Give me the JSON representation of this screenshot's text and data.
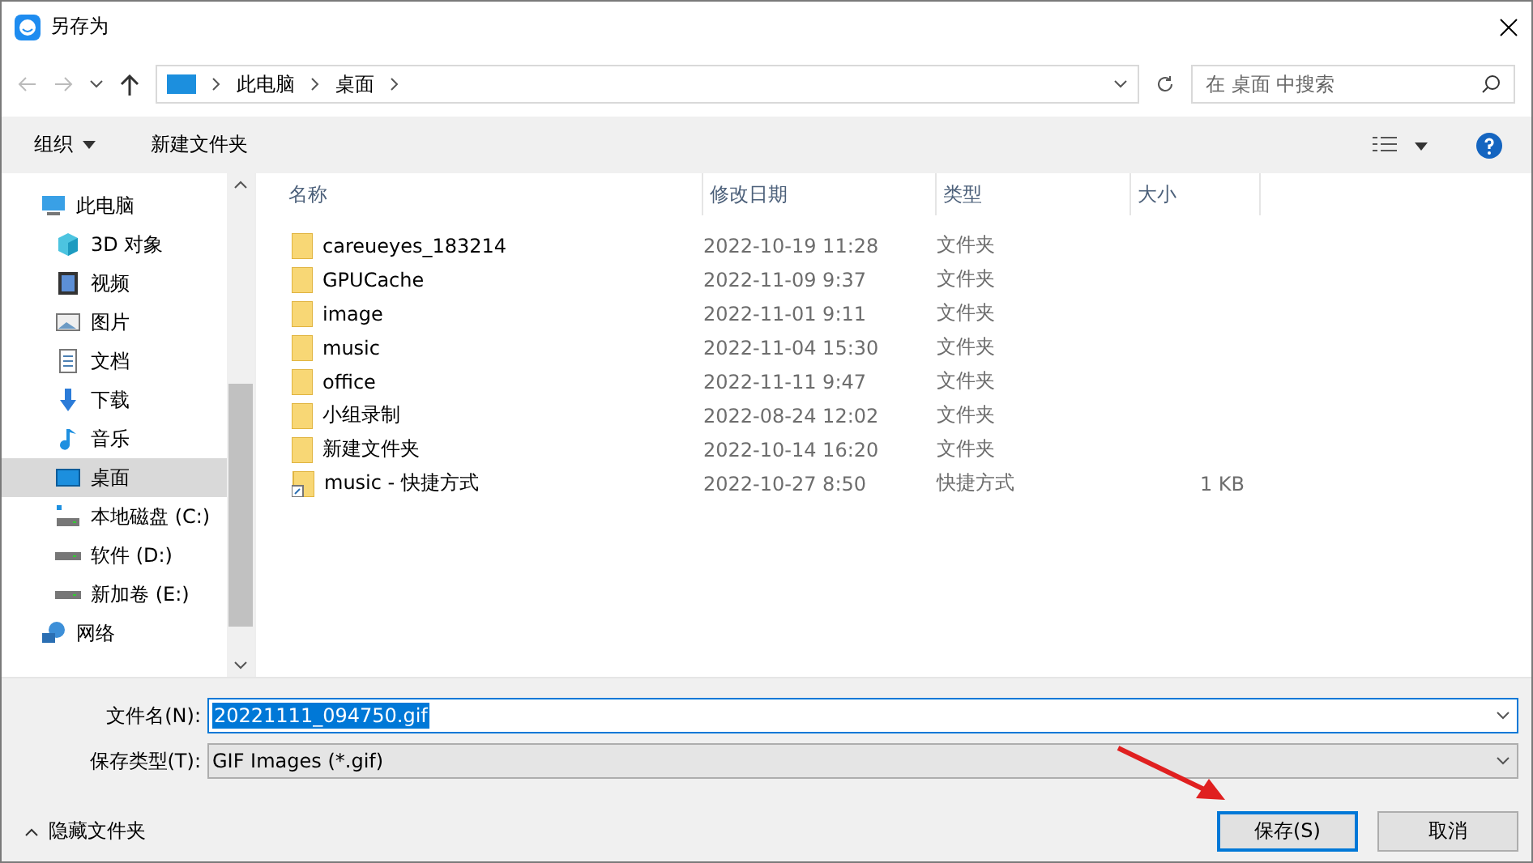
{
  "window": {
    "title": "另存为"
  },
  "nav": {
    "path": [
      "此电脑",
      "桌面"
    ],
    "search_placeholder": "在 桌面 中搜索"
  },
  "toolbar": {
    "organize": "组织",
    "new_folder": "新建文件夹"
  },
  "sidebar": {
    "items": [
      {
        "label": "此电脑",
        "kind": "pc",
        "selected": false,
        "children": [
          {
            "label": "3D 对象",
            "kind": "cube",
            "selected": false
          },
          {
            "label": "视频",
            "kind": "video",
            "selected": false
          },
          {
            "label": "图片",
            "kind": "picture",
            "selected": false
          },
          {
            "label": "文档",
            "kind": "doc",
            "selected": false
          },
          {
            "label": "下载",
            "kind": "download",
            "selected": false
          },
          {
            "label": "音乐",
            "kind": "music",
            "selected": false
          },
          {
            "label": "桌面",
            "kind": "desktop",
            "selected": true
          },
          {
            "label": "本地磁盘 (C:)",
            "kind": "system-drive",
            "selected": false
          },
          {
            "label": "软件 (D:)",
            "kind": "drive",
            "selected": false
          },
          {
            "label": "新加卷 (E:)",
            "kind": "drive",
            "selected": false
          }
        ]
      },
      {
        "label": "网络",
        "kind": "network",
        "selected": false
      }
    ]
  },
  "table": {
    "columns": [
      "名称",
      "修改日期",
      "类型",
      "大小"
    ],
    "rows": [
      {
        "name": "careueyes_183214",
        "date": "2022-10-19 11:28",
        "type": "文件夹",
        "kind": "folder"
      },
      {
        "name": "GPUCache",
        "date": "2022-11-09 9:37",
        "type": "文件夹",
        "kind": "folder"
      },
      {
        "name": "image",
        "date": "2022-11-01 9:11",
        "type": "文件夹",
        "kind": "folder"
      },
      {
        "name": "music",
        "date": "2022-11-04 15:30",
        "type": "文件夹",
        "kind": "folder"
      },
      {
        "name": "office",
        "date": "2022-11-11 9:47",
        "type": "文件夹",
        "kind": "folder"
      },
      {
        "name": "小组录制",
        "date": "2022-08-24 12:02",
        "type": "文件夹",
        "kind": "folder"
      },
      {
        "name": "新建文件夹",
        "date": "2022-10-14 16:20",
        "type": "文件夹",
        "kind": "folder"
      },
      {
        "name": "music - 快捷方式",
        "date": "2022-10-27 8:50",
        "type": "快捷方式",
        "size": "1 KB",
        "kind": "shortcut"
      }
    ]
  },
  "form": {
    "filename_label": "文件名(N):",
    "filename": "20221111_094750.gif",
    "type_label": "保存类型(T):",
    "type": "GIF Images (*.gif)"
  },
  "footer": {
    "hide_folders": "隐藏文件夹",
    "save": "保存(S)",
    "cancel": "取消"
  }
}
